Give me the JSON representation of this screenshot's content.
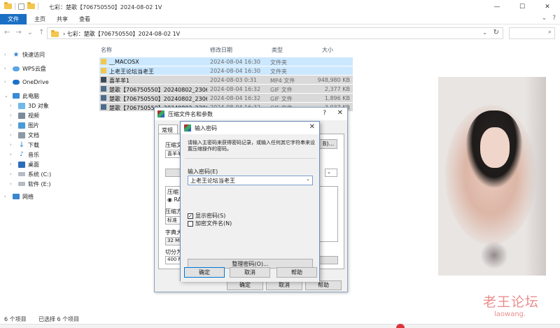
{
  "explorer": {
    "title": "七彩：楚歌【706750550】2024-08-02 1V",
    "ribbon_tabs": [
      "文件",
      "主页",
      "共享",
      "查看"
    ],
    "address_path": "› 七彩：楚歌【706750550】2024-08-02 1V",
    "columns": {
      "name": "名称",
      "date": "修改日期",
      "type": "类型",
      "size": "大小"
    },
    "files": [
      {
        "name": "__MACOSX",
        "date": "2024-08-04 16:30",
        "type": "文件夹",
        "size": "",
        "icon": "folder"
      },
      {
        "name": "上老王论坛当老王",
        "date": "2024-08-04 16:30",
        "type": "文件夹",
        "size": "",
        "icon": "folder"
      },
      {
        "name": "喜羊羊1",
        "date": "2024-08-03 0:31",
        "type": "MP4 文件",
        "size": "948,980 KB",
        "icon": "mp4"
      },
      {
        "name": "楚歌【706750550】20240802_230607...",
        "date": "2024-08-04 16:32",
        "type": "GIF 文件",
        "size": "2,377 KB",
        "icon": "gif"
      },
      {
        "name": "楚歌【706750550】20240802_230607...",
        "date": "2024-08-04 16:32",
        "type": "GIF 文件",
        "size": "1,896 KB",
        "icon": "gif"
      },
      {
        "name": "楚歌【706750550】20240802_230607...",
        "date": "2024-08-04 16:32",
        "type": "GIF 文件",
        "size": "3,037 KB",
        "icon": "gif"
      }
    ],
    "sidebar": [
      {
        "label": "快速访问",
        "icon": "star-icon"
      },
      {
        "label": "WPS云盘",
        "icon": "cloud-icon"
      },
      {
        "label": "OneDrive",
        "icon": "onedrive-icon"
      },
      {
        "label": "此电脑",
        "icon": "pc-icon"
      },
      {
        "label": "3D 对象",
        "icon": "3d-icon"
      },
      {
        "label": "视频",
        "icon": "video-icon"
      },
      {
        "label": "图片",
        "icon": "picture-icon"
      },
      {
        "label": "文档",
        "icon": "document-icon"
      },
      {
        "label": "下载",
        "icon": "download-icon"
      },
      {
        "label": "音乐",
        "icon": "music-icon"
      },
      {
        "label": "桌面",
        "icon": "desktop-icon"
      },
      {
        "label": "系统 (C:)",
        "icon": "drive-icon"
      },
      {
        "label": "软件 (E:)",
        "icon": "drive-icon"
      },
      {
        "label": "网络",
        "icon": "network-icon"
      }
    ],
    "status": {
      "count": "6 个项目",
      "selected": "已选择 6 个项目"
    }
  },
  "rar_dialog": {
    "title": "压缩文件名和参数",
    "help": "?",
    "tab": "常规",
    "label_archive": "压缩文",
    "archive_value": "喜羊羊",
    "label_format": "压缩",
    "format_option": "RA",
    "label_method": "压缩方",
    "method_value": "标准",
    "label_dict": "字典大",
    "dict_value": "32 MB",
    "label_split": "切分为",
    "split_value": "400 MB",
    "browse": "B)...",
    "ok": "确定",
    "cancel": "取消",
    "help_btn": "帮助"
  },
  "password_dialog": {
    "title": "输入密码",
    "description": "请输入主密码来获得密码记录，或输入任何其它字符串来设置压缩操作的密码。",
    "label": "输入密码(E)",
    "value": "上老王论坛当老王",
    "show_password": "显示密码(S)",
    "show_password_checked": true,
    "encrypt_names": "加密文件名(N)",
    "encrypt_names_checked": false,
    "manage": "整理密码(O)...",
    "ok": "确定",
    "cancel": "取消",
    "help": "帮助"
  },
  "watermark": {
    "cn": "老王论坛",
    "en": "laowang."
  }
}
